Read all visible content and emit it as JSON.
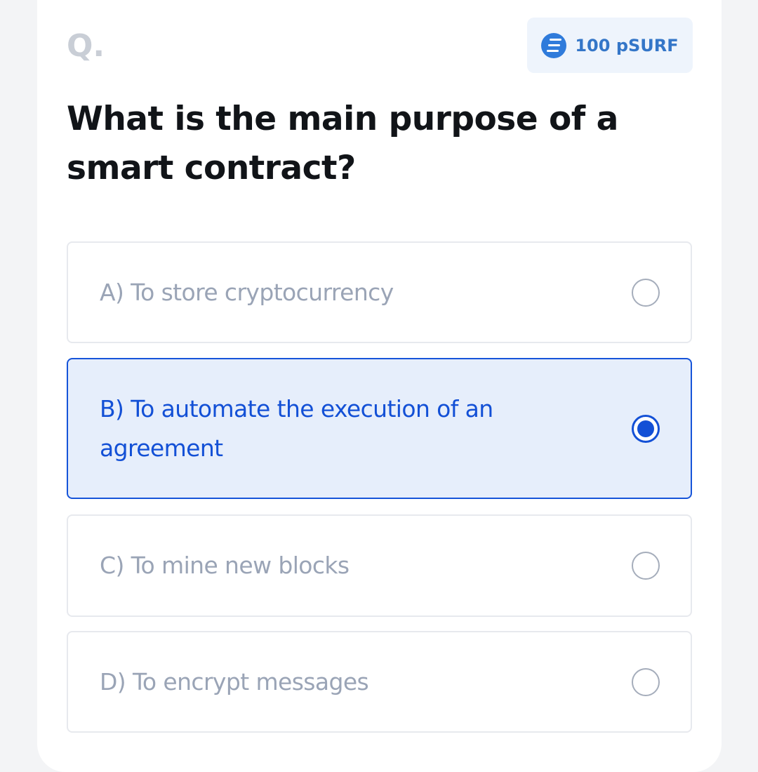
{
  "question_marker": "Q.",
  "reward": {
    "amount_label": "100 pSURF",
    "icon": "surf-token-icon",
    "color": "#3476c8"
  },
  "question": {
    "text": "What is the main purpose of a smart contract?"
  },
  "options": [
    {
      "label": "A) To store cryptocurrency",
      "selected": false
    },
    {
      "label": "B) To automate the execution of an agreement",
      "selected": true
    },
    {
      "label": "C) To mine new blocks",
      "selected": false
    },
    {
      "label": "D) To encrypt messages",
      "selected": false
    }
  ],
  "colors": {
    "selected_accent": "#1350d6",
    "selected_background": "#e6eefb",
    "unselected_text": "#9aa4b6"
  }
}
